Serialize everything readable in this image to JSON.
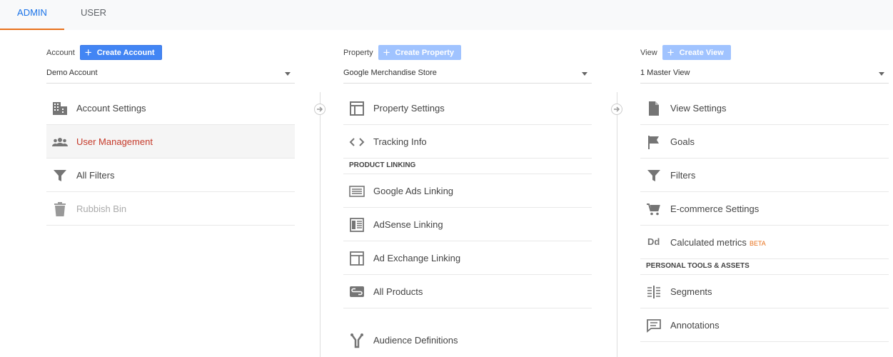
{
  "tabs": {
    "admin": "ADMIN",
    "user": "USER"
  },
  "account": {
    "label": "Account",
    "create_label": "Create Account",
    "selected": "Demo Account",
    "items": [
      {
        "label": "Account Settings",
        "icon": "building-icon"
      },
      {
        "label": "User Management",
        "icon": "people-icon"
      },
      {
        "label": "All Filters",
        "icon": "filter-icon"
      },
      {
        "label": "Rubbish Bin",
        "icon": "trash-icon"
      }
    ]
  },
  "property": {
    "label": "Property",
    "create_label": "Create Property",
    "selected": "Google Merchandise Store",
    "items": [
      {
        "label": "Property Settings",
        "icon": "layout-icon"
      },
      {
        "label": "Tracking Info",
        "icon": "code-icon"
      }
    ],
    "section": "PRODUCT LINKING",
    "linking_items": [
      {
        "label": "Google Ads Linking",
        "icon": "ads-icon"
      },
      {
        "label": "AdSense Linking",
        "icon": "adsense-icon"
      },
      {
        "label": "Ad Exchange Linking",
        "icon": "adexchange-icon"
      },
      {
        "label": "All Products",
        "icon": "link-icon"
      },
      {
        "label": "Audience Definitions",
        "icon": "audience-icon"
      }
    ]
  },
  "view": {
    "label": "View",
    "create_label": "Create View",
    "selected": "1 Master View",
    "items": [
      {
        "label": "View Settings",
        "icon": "document-icon"
      },
      {
        "label": "Goals",
        "icon": "flag-icon"
      },
      {
        "label": "Filters",
        "icon": "filter-icon"
      },
      {
        "label": "E-commerce Settings",
        "icon": "cart-icon"
      },
      {
        "label": "Calculated metrics",
        "icon": "dd-icon",
        "badge": "BETA"
      }
    ],
    "section": "PERSONAL TOOLS & ASSETS",
    "tools_items": [
      {
        "label": "Segments",
        "icon": "segments-icon"
      },
      {
        "label": "Annotations",
        "icon": "comment-icon"
      }
    ]
  },
  "colors": {
    "accent": "#1a73e8",
    "tab_indicator": "#e8711c",
    "active_text": "#c53929",
    "button": "#4285f4"
  }
}
